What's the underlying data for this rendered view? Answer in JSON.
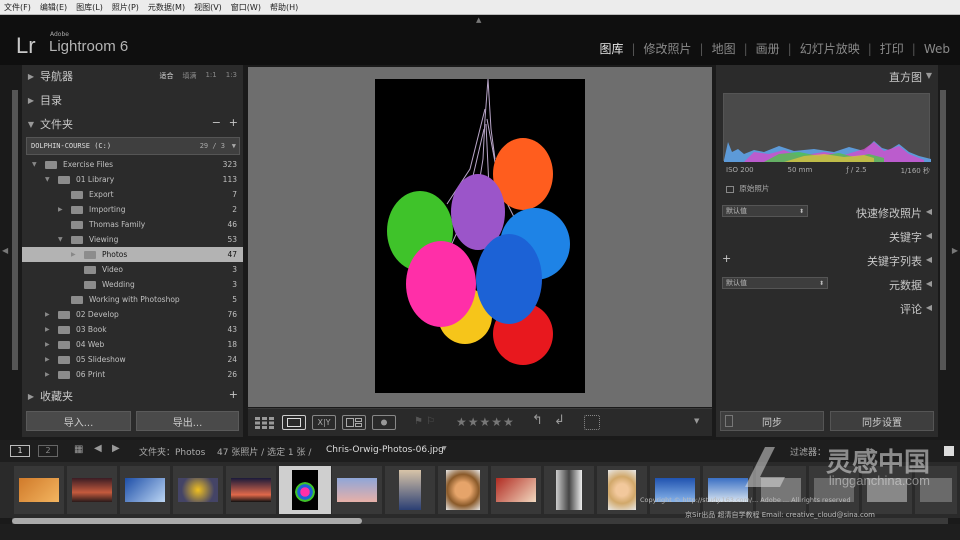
{
  "menubar": {
    "items": [
      "文件(F)",
      "编辑(E)",
      "图库(L)",
      "照片(P)",
      "元数据(M)",
      "视图(V)",
      "窗口(W)",
      "帮助(H)"
    ]
  },
  "header": {
    "logo": "Lr",
    "adobe": "Adobe",
    "app_name": "Lightroom 6"
  },
  "modules": [
    {
      "label": "图库",
      "active": true
    },
    {
      "label": "修改照片"
    },
    {
      "label": "地图"
    },
    {
      "label": "画册"
    },
    {
      "label": "幻灯片放映"
    },
    {
      "label": "打印"
    },
    {
      "label": "Web"
    }
  ],
  "left": {
    "navigator": "导航器",
    "nav_options": [
      "适合",
      "填满",
      "1:1",
      "1:3"
    ],
    "catalog": "目录",
    "folders": "文件夹",
    "folders_ctrl": [
      "−",
      "+"
    ],
    "volume": {
      "name": "DOLPHIN-COURSE (C:)",
      "value": "29 / 3"
    },
    "folder_rows": [
      {
        "label": "Exercise Files",
        "count": "323"
      },
      {
        "label": "01 Library",
        "count": "113"
      },
      {
        "label": "Export",
        "count": "7"
      },
      {
        "label": "Importing",
        "count": "2"
      },
      {
        "label": "Thomas Family",
        "count": "46"
      },
      {
        "label": "Viewing",
        "count": "53"
      },
      {
        "label": "Photos",
        "count": "47"
      },
      {
        "label": "Video",
        "count": "3"
      },
      {
        "label": "Wedding",
        "count": "3"
      },
      {
        "label": "Working with Photoshop",
        "count": "5"
      },
      {
        "label": "02 Develop",
        "count": "76"
      },
      {
        "label": "03 Book",
        "count": "43"
      },
      {
        "label": "04 Web",
        "count": "18"
      },
      {
        "label": "05 Slideshow",
        "count": "24"
      },
      {
        "label": "06 Print",
        "count": "26"
      }
    ],
    "collections": "收藏夹",
    "collections_plus": "+",
    "import_label": "导入...",
    "export_label": "导出..."
  },
  "toolbar": {
    "flag_icons": "⚑ ⚐",
    "stars": "★★★★★",
    "xy": "X|Y"
  },
  "right": {
    "histogram": "直方图",
    "iso": "ISO 200",
    "focal": "50 mm",
    "aperture": "ƒ / 2.5",
    "shutter": "1/160 秒",
    "original_photo": "原始照片",
    "default1": "默认值",
    "quick_develop": "快速修改照片",
    "keywording": "关键字",
    "keyword_list": "关键字列表",
    "keyword_plus": "+",
    "default2": "默认值",
    "metadata": "元数据",
    "comments": "评论",
    "sync_label": "同步",
    "sync_settings_label": "同步设置"
  },
  "filmbar": {
    "page1": "1",
    "page2": "2",
    "source": "文件夹：Photos",
    "count": "47 张照片 / 选定 1 张 /",
    "filename": "Chris-Orwig-Photos-06.jpg",
    "filter": "过滤器："
  },
  "watermark": {
    "big": "灵感中国",
    "site": "lingganchina.com"
  },
  "copyright": "Copyright © http://study.163.com/... Adobe ... All rights reserved",
  "credit": "京Sir出品 超清自学教程 Email: creative_cloud@sina.com",
  "colors": {
    "accent": "#e6e6e6",
    "panel": "#2b2b2b",
    "center": "#6e6e6e"
  }
}
